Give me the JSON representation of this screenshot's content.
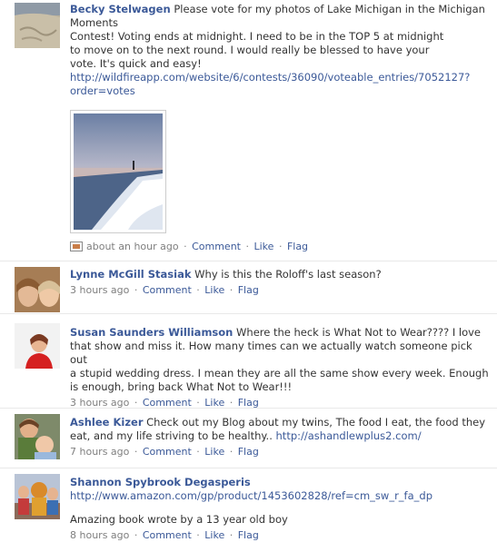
{
  "posts": [
    {
      "author": "Becky Stelwagen",
      "lines": [
        "Please vote for my photos of Lake Michigan in the Michigan",
        "Moments",
        "Contest! Voting ends at midnight. I need to be in the TOP 5 at midnight",
        "to move on to the next round. I would really be blessed to have your",
        "vote. It's quick and easy!"
      ],
      "link_lines": [
        "http://wildfireapp.com/website/6/contests/36090/voteable_entries/7052127?",
        "order=votes"
      ],
      "time": "about an hour ago",
      "actions": [
        "Comment",
        "Like",
        "Flag"
      ]
    },
    {
      "author": "Lynne McGill Stasiak",
      "text": "Why is this the Roloff's last season?",
      "time": "3 hours ago",
      "actions": [
        "Comment",
        "Like",
        "Flag"
      ]
    },
    {
      "author": "Susan Saunders Williamson",
      "lines": [
        "Where the heck is What Not to Wear???? I love",
        "that show and miss it. How many times can we actually watch someone pick out",
        "a stupid wedding dress. I mean they are all the same show every week. Enough",
        "is enough, bring back What Not to Wear!!!"
      ],
      "time": "3 hours ago",
      "actions": [
        "Comment",
        "Like",
        "Flag"
      ]
    },
    {
      "author": "Ashlee Kizer",
      "lines": [
        "Check out my Blog about my twins, The food I eat, the food they",
        "eat, and my life striving to be healthy.. "
      ],
      "link": "http://ashandlewplus2.com/",
      "time": "7 hours ago",
      "actions": [
        "Comment",
        "Like",
        "Flag"
      ]
    },
    {
      "author": "Shannon Spybrook Degasperis",
      "link": "http://www.amazon.com/gp/product/1453602828/ref=cm_sw_r_fa_dp",
      "text": "Amazing book wrote by a 13 year old boy",
      "time": "8 hours ago",
      "actions": [
        "Comment",
        "Like",
        "Flag"
      ]
    }
  ],
  "colors": {
    "link": "#3b5998",
    "meta": "#7f7f7f",
    "text": "#333333"
  }
}
